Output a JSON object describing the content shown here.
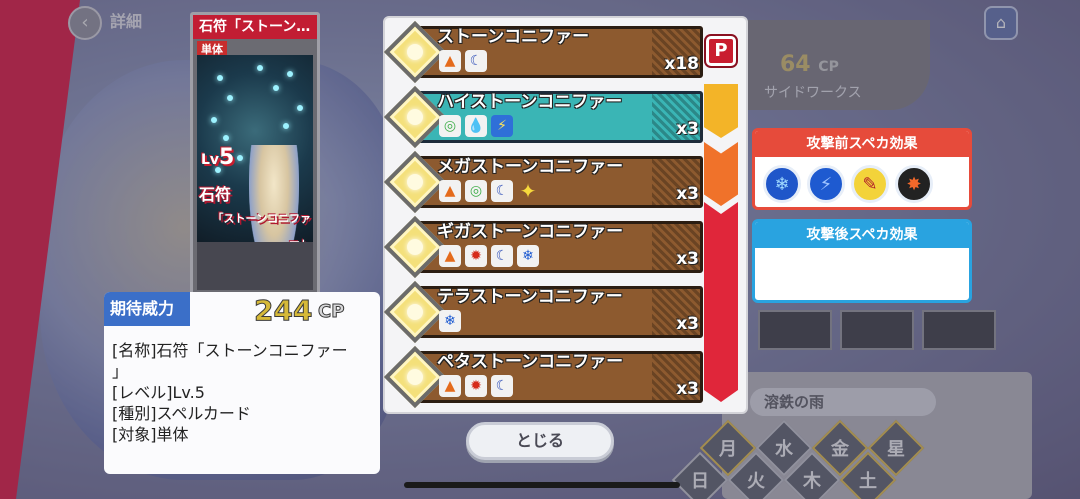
{
  "header": {
    "back_icon": "chevron-left-icon",
    "title": "詳細",
    "home_icon": "home-icon"
  },
  "background": {
    "cp_value": "64",
    "cp_unit": "CP",
    "sideworks_label": "サイドワークス",
    "rain_name": "溶鉄の雨",
    "elements": [
      "月",
      "水",
      "金",
      "星",
      "火",
      "木",
      "日",
      "土"
    ]
  },
  "card": {
    "header": "石符「ストーン…",
    "target_tag": "単体",
    "level_prefix": "Lv",
    "level_value": "5",
    "name_top": "石符",
    "name_bottom": "「ストーンコニファー」"
  },
  "info": {
    "power_label": "期待威力",
    "power_value": "244",
    "power_unit": "CP",
    "lines": [
      "[名称]石符「ストーンコニファー",
      "」",
      "[レベル]Lv.5",
      "[種別]スペルカード",
      "[対象]単体"
    ]
  },
  "spells": [
    {
      "name": "ストーンコニファー",
      "count": "x18",
      "style": "brown",
      "icons": [
        "fire",
        "moon"
      ]
    },
    {
      "name": "ハイストーンコニファー",
      "count": "x3",
      "style": "cyan",
      "icons": [
        "wind",
        "water",
        "bolt"
      ]
    },
    {
      "name": "メガストーンコニファー",
      "count": "x3",
      "style": "brown",
      "icons": [
        "fire",
        "wind",
        "moon",
        "star"
      ]
    },
    {
      "name": "ギガストーンコニファー",
      "count": "x3",
      "style": "brown",
      "icons": [
        "fire",
        "sun",
        "moon",
        "ice"
      ]
    },
    {
      "name": "テラストーンコニファー",
      "count": "x3",
      "style": "brown",
      "icons": [
        "ice"
      ]
    },
    {
      "name": "ペタストーンコニファー",
      "count": "x3",
      "style": "brown",
      "icons": [
        "fire",
        "sun",
        "moon"
      ]
    }
  ],
  "p_badge": "P",
  "effects": {
    "pre_title": "攻撃前スペカ効果",
    "pre_icons": [
      "snowflake-icon",
      "bolt-icon",
      "feather-icon",
      "fire-icon"
    ],
    "post_title": "攻撃後スペカ効果"
  },
  "close_label": "とじる",
  "colors": {
    "accent_red": "#e2264f",
    "brown_bar": "#8d5a2f",
    "cyan_bar": "#3ab5b5",
    "power_gold": "#d6b938",
    "pre_effect": "#e64b3b",
    "post_effect": "#29a3e0"
  }
}
